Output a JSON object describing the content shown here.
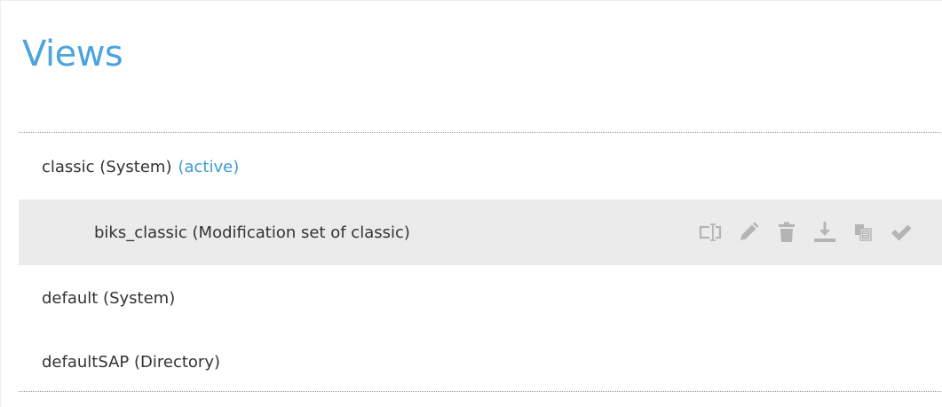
{
  "header": {
    "title": "Views"
  },
  "views": [
    {
      "name": "classic (System)",
      "active_label": "(active)",
      "level": 0
    },
    {
      "name": "biks_classic (Modification set of classic)",
      "level": 1,
      "selected": true,
      "actions": [
        {
          "name": "rename",
          "icon": "rename-icon"
        },
        {
          "name": "edit",
          "icon": "pencil-icon"
        },
        {
          "name": "delete",
          "icon": "trash-icon"
        },
        {
          "name": "download",
          "icon": "download-icon"
        },
        {
          "name": "copy",
          "icon": "copy-icon"
        },
        {
          "name": "activate",
          "icon": "checkmark-icon"
        }
      ]
    },
    {
      "name": "default (System)",
      "level": 0
    },
    {
      "name": "defaultSAP (Directory)",
      "level": 0
    }
  ],
  "colors": {
    "title": "#4ba4dd",
    "active_tag": "#3d9ad6",
    "selected_row_bg": "#ebebeb",
    "icon": "#b4b4b4",
    "text": "#333333"
  }
}
